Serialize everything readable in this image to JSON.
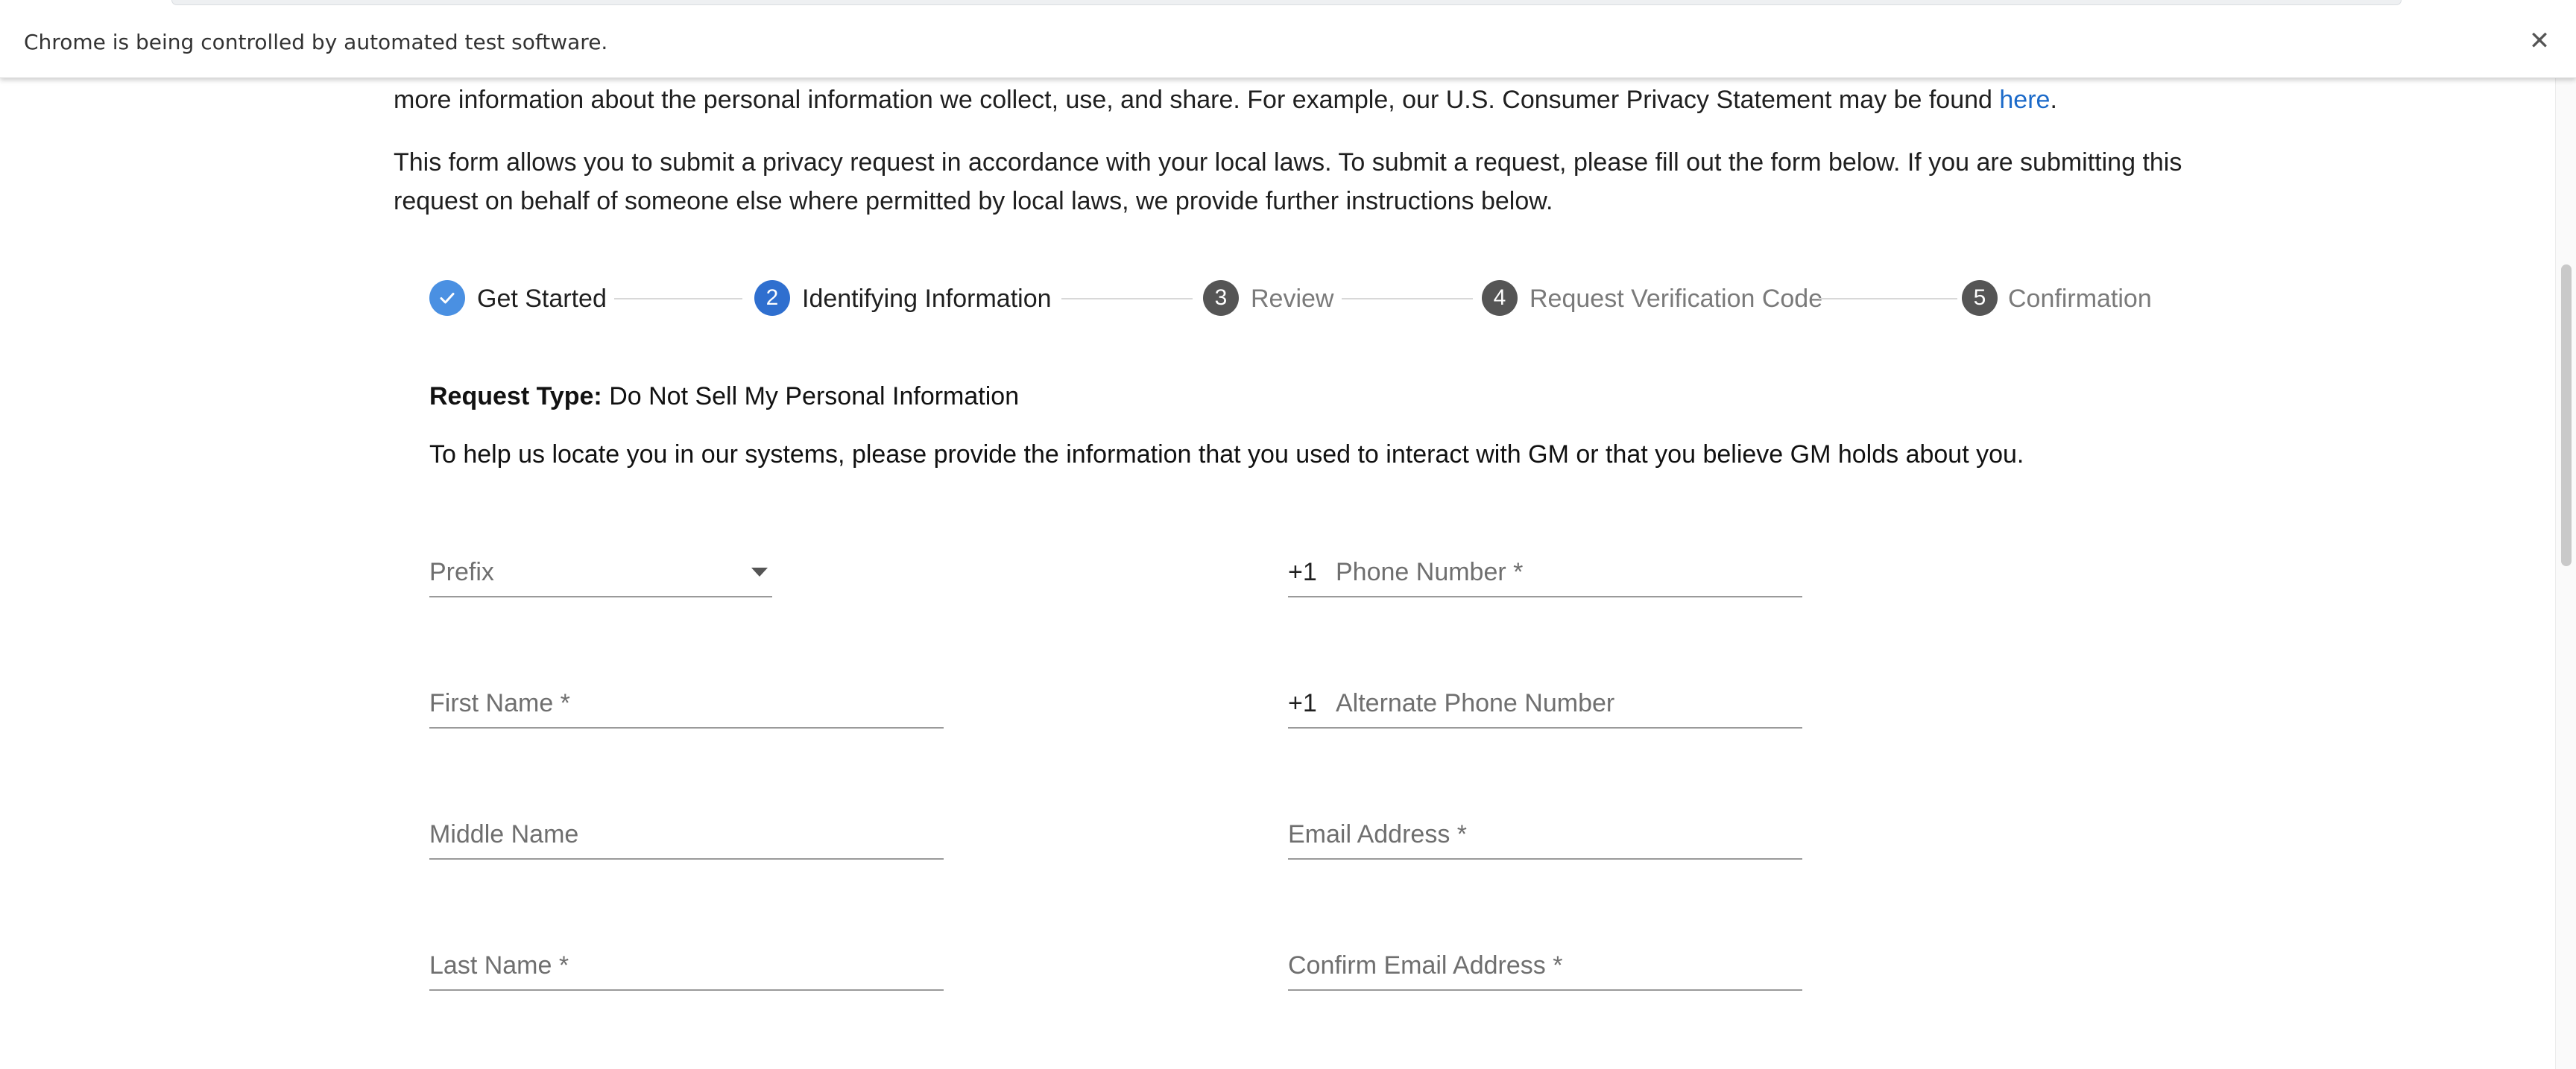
{
  "infobar": {
    "message": "Chrome is being controlled by automated test software.",
    "close_glyph": "✕"
  },
  "intro": {
    "p1_text": "more information about the personal information we collect, use, and share. For example, our U.S. Consumer Privacy Statement may be found ",
    "p1_link": "here",
    "p1_end": ".",
    "p2_text": "This form allows you to submit a privacy request in accordance with your local laws. To submit a request, please fill out the form below. If you are submitting this request on behalf of someone else where permitted by local laws, we provide further instructions below."
  },
  "stepper": {
    "steps": [
      {
        "number": "✓",
        "label": "Get Started",
        "state": "done"
      },
      {
        "number": "2",
        "label": "Identifying Information",
        "state": "active"
      },
      {
        "number": "3",
        "label": "Review",
        "state": "pending"
      },
      {
        "number": "4",
        "label": "Request Verification Code",
        "state": "pending"
      },
      {
        "number": "5",
        "label": "Confirmation",
        "state": "pending"
      }
    ]
  },
  "request": {
    "type_label": "Request Type:",
    "type_value": "Do Not Sell My Personal Information",
    "help_text": "To help us locate you in our systems, please provide the information that you used to interact with GM or that you believe GM holds about you."
  },
  "form": {
    "prefix": {
      "placeholder": "Prefix",
      "value": ""
    },
    "first_name": {
      "placeholder": "First Name *",
      "value": ""
    },
    "middle_name": {
      "placeholder": "Middle Name",
      "value": ""
    },
    "last_name": {
      "placeholder": "Last Name *",
      "value": ""
    },
    "phone": {
      "country_code": "+1",
      "placeholder": "Phone Number *",
      "value": ""
    },
    "alt_phone": {
      "country_code": "+1",
      "placeholder": "Alternate Phone Number",
      "value": ""
    },
    "email": {
      "placeholder": "Email Address *",
      "value": ""
    },
    "confirm_email": {
      "placeholder": "Confirm Email Address *",
      "value": ""
    }
  },
  "colors": {
    "link": "#1b6ac9",
    "step_done": "#4a90e2",
    "step_active": "#2f6fcf",
    "step_pending": "#555555"
  }
}
